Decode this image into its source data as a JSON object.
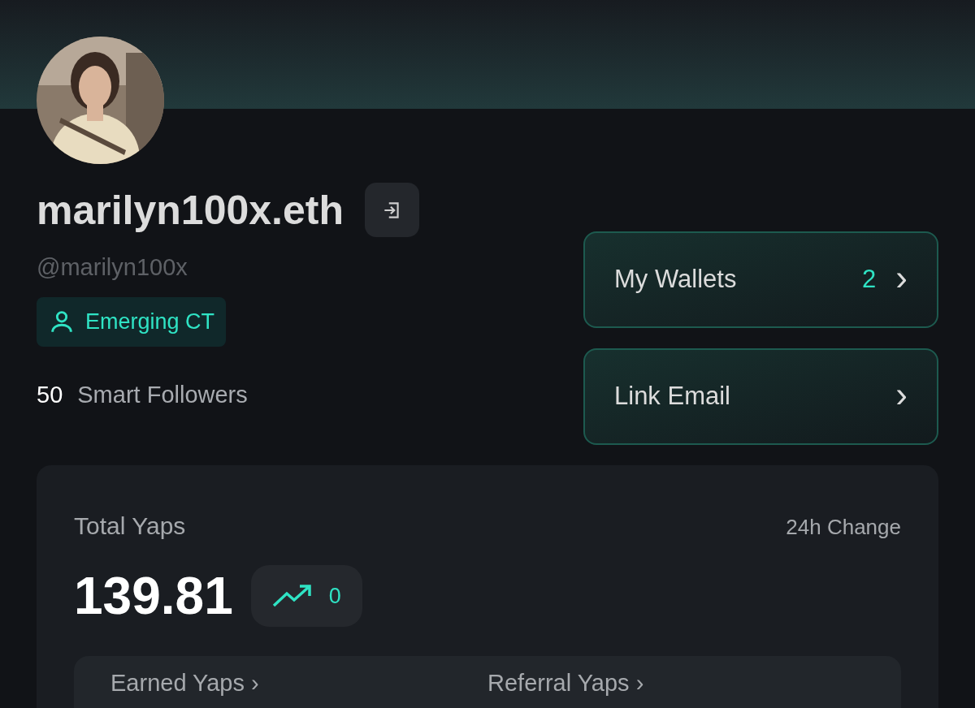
{
  "profile": {
    "name": "marilyn100x.eth",
    "handle": "@marilyn100x",
    "badge": "Emerging CT",
    "followers_count": "50",
    "followers_label": "Smart Followers"
  },
  "actions": [
    {
      "label": "My Wallets",
      "count": "2",
      "chevron": "›"
    },
    {
      "label": "Link Email",
      "chevron": "›"
    }
  ],
  "yaps": {
    "title": "Total Yaps",
    "change_label": "24h Change",
    "total": "139.81",
    "change": "0",
    "breakdown": [
      {
        "label": "Earned Yaps",
        "chevron": "›"
      },
      {
        "label": "Referral Yaps",
        "chevron": "›"
      }
    ]
  }
}
